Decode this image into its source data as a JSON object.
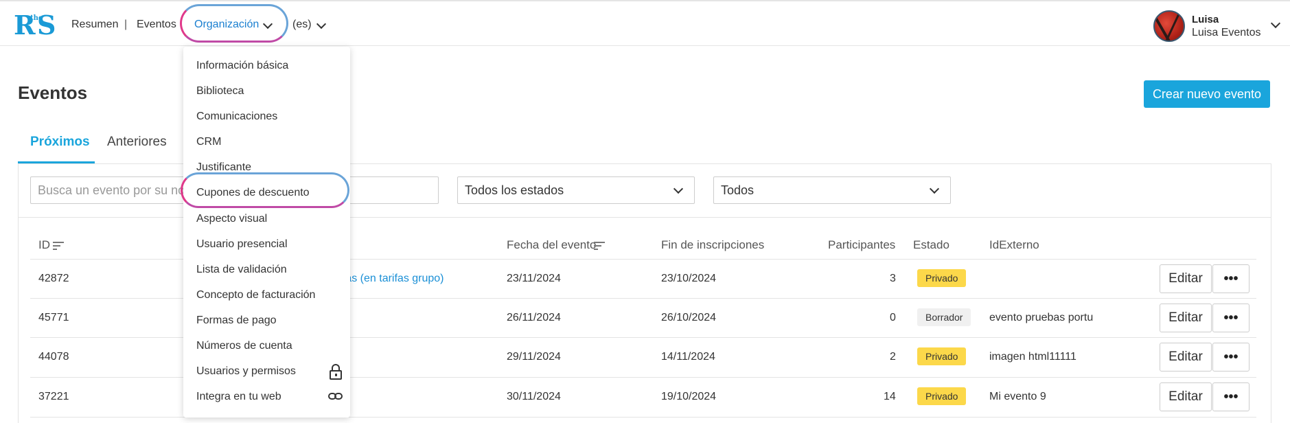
{
  "header": {
    "logo": {
      "r": "R",
      "the": "the",
      "s": "S"
    },
    "nav": {
      "summary": "Resumen",
      "separator": "|",
      "events": "Eventos",
      "organization": "Organización",
      "language": "(es)"
    },
    "user": {
      "name": "Luisa",
      "org": "Luisa Eventos"
    }
  },
  "page": {
    "title": "Eventos",
    "create_button": "Crear nuevo evento"
  },
  "tabs": [
    {
      "label": "Próximos",
      "active": true
    },
    {
      "label": "Anteriores",
      "active": false
    }
  ],
  "filters": {
    "search_placeholder": "Busca un evento por su nombre",
    "status_select": "Todos los estados",
    "type_select": "Todos"
  },
  "table": {
    "headers": {
      "id": "ID",
      "date": "Fecha del evento",
      "reg_end": "Fin de inscripciones",
      "participants": "Participantes",
      "status": "Estado",
      "external": "IdExterno"
    },
    "rows": [
      {
        "id": "42872",
        "name": "rifas (en tarifas grupo)",
        "date": "23/11/2024",
        "reg_end": "23/10/2024",
        "participants": "3",
        "status": "Privado",
        "external": "",
        "edit": "Editar",
        "more": "•••"
      },
      {
        "id": "45771",
        "name": "",
        "date": "26/11/2024",
        "reg_end": "26/10/2024",
        "participants": "0",
        "status": "Borrador",
        "external": "evento pruebas portu",
        "edit": "Editar",
        "more": "•••"
      },
      {
        "id": "44078",
        "name": "",
        "date": "29/11/2024",
        "reg_end": "14/11/2024",
        "participants": "2",
        "status": "Privado",
        "external": "imagen html11111",
        "edit": "Editar",
        "more": "•••"
      },
      {
        "id": "37221",
        "name": "",
        "date": "30/11/2024",
        "reg_end": "19/10/2024",
        "participants": "14",
        "status": "Privado",
        "external": "Mi evento 9",
        "edit": "Editar",
        "more": "•••"
      }
    ]
  },
  "dropdown": {
    "items": [
      {
        "label": "Información básica"
      },
      {
        "label": "Biblioteca"
      },
      {
        "label": "Comunicaciones"
      },
      {
        "label": "CRM"
      },
      {
        "label": "Justificante"
      },
      {
        "label": "Cupones de descuento",
        "highlighted": true
      },
      {
        "label": "Aspecto visual"
      },
      {
        "label": "Usuario presencial"
      },
      {
        "label": "Lista de validación"
      },
      {
        "label": "Concepto de facturación"
      },
      {
        "label": "Formas de pago"
      },
      {
        "label": "Números de cuenta"
      },
      {
        "label": "Usuarios y permisos",
        "icon": "lock-icon"
      },
      {
        "label": "Integra en tu web",
        "icon": "link-icon"
      }
    ]
  },
  "colors": {
    "accent": "#1aa5dc",
    "link": "#1a8fd6",
    "badge_private": "#fcd84a",
    "badge_draft": "#f0f0f0",
    "highlight_pink": "#e0388a",
    "highlight_blue": "#6aa4d8"
  }
}
